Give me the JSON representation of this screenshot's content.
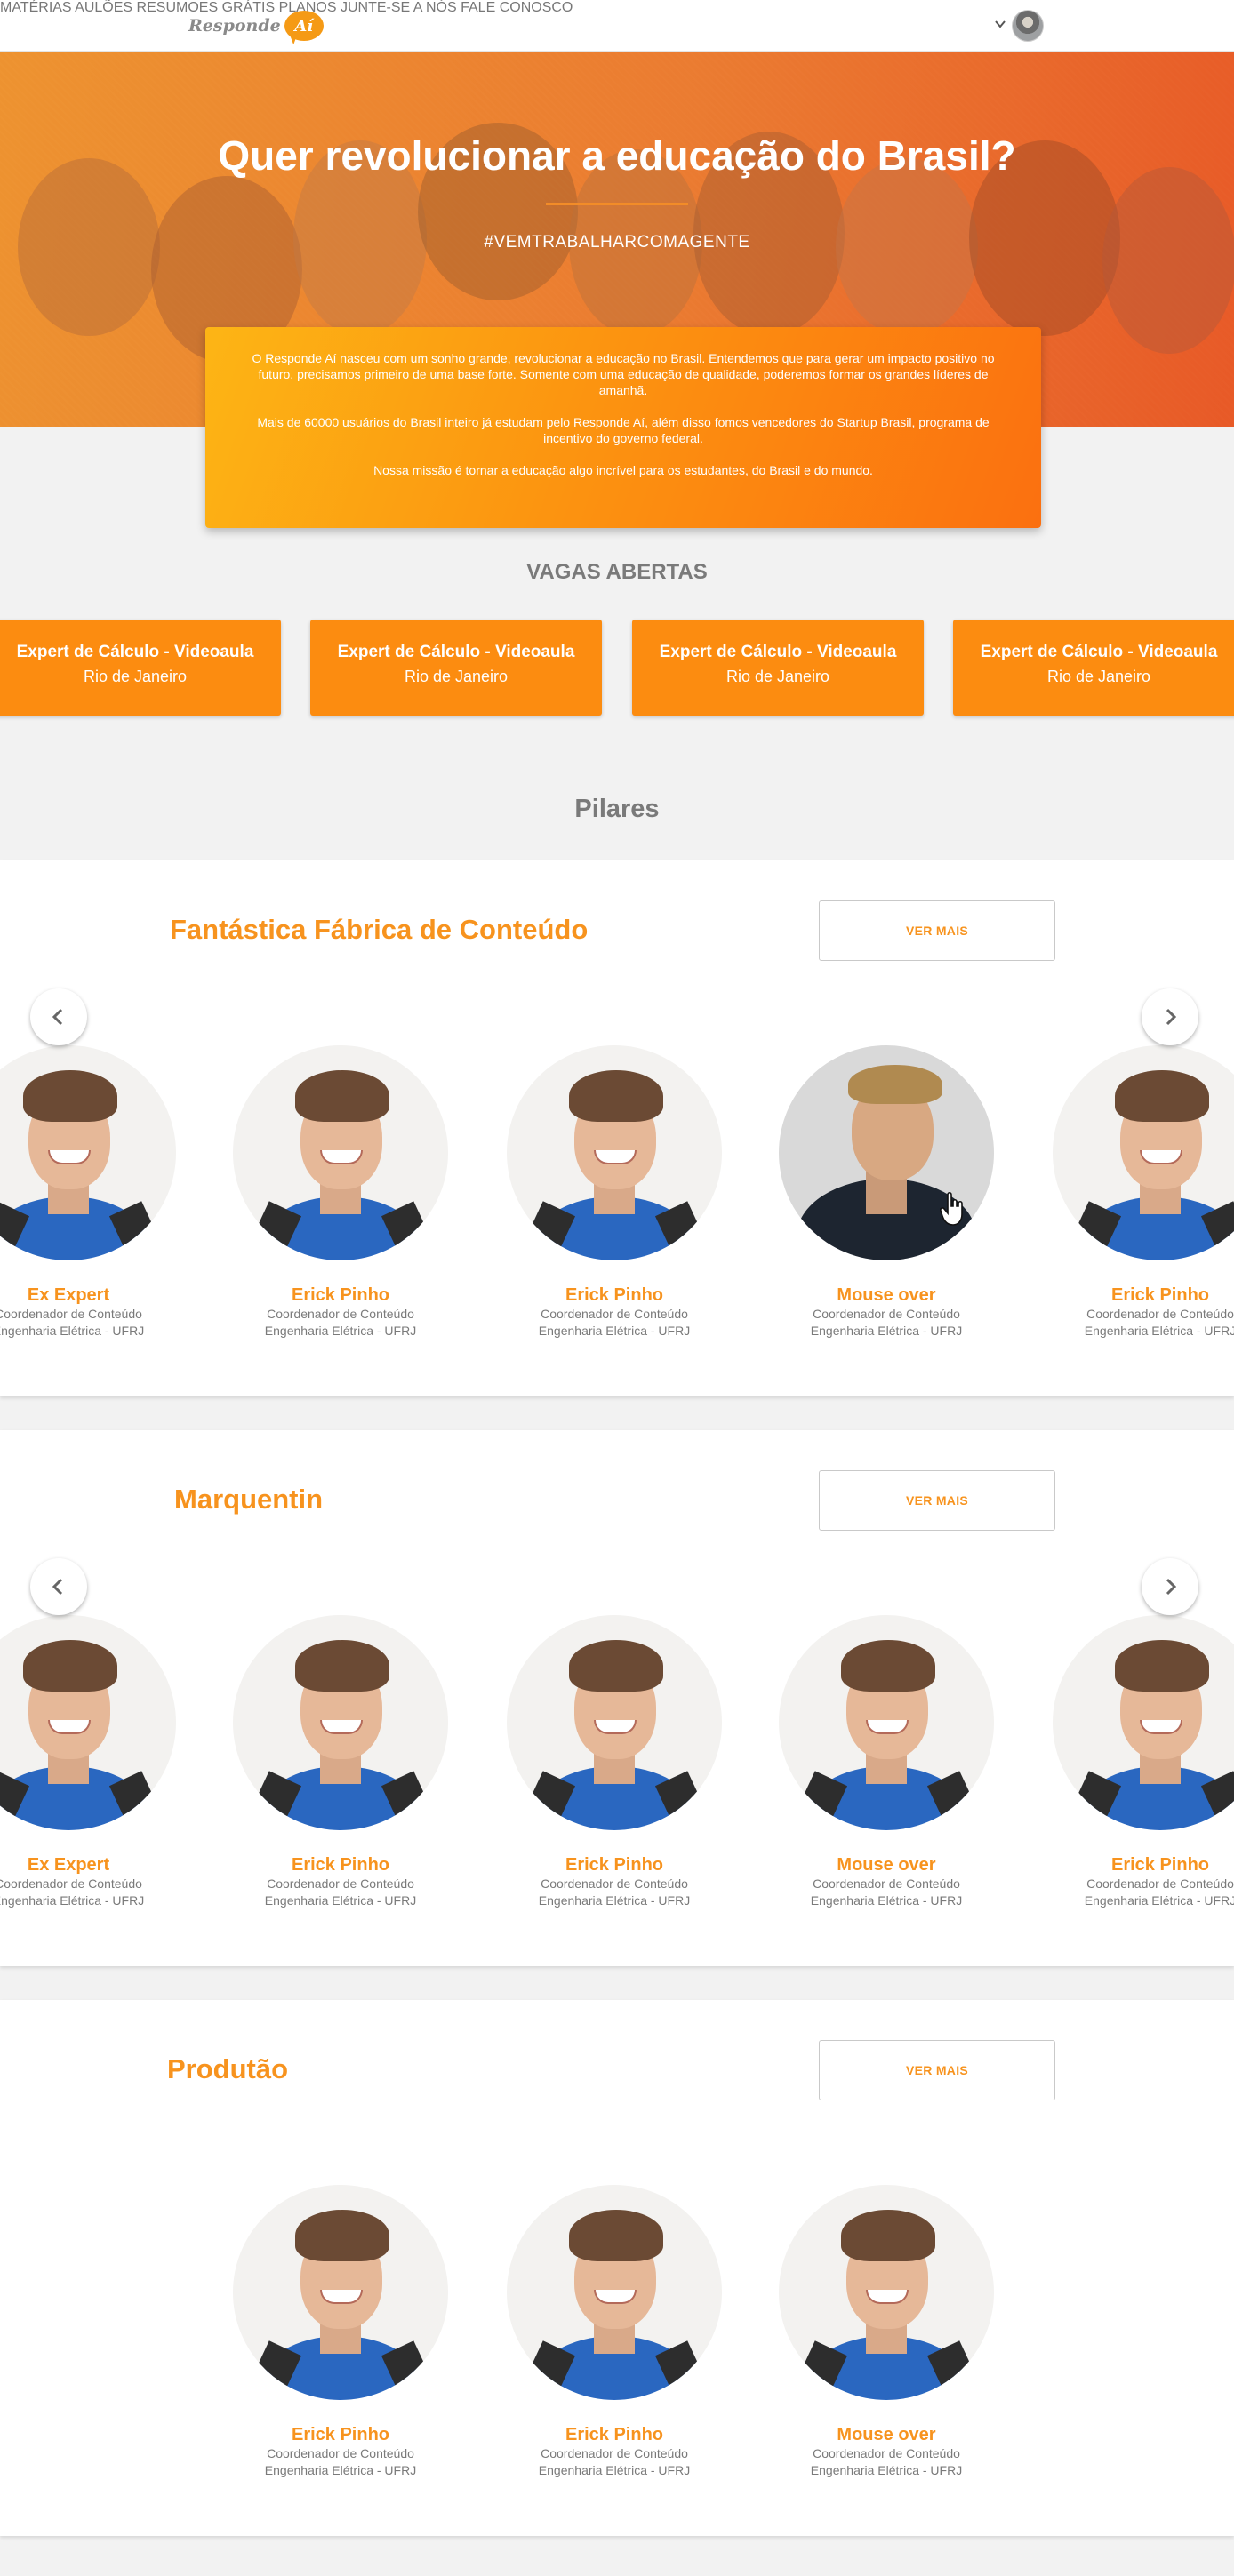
{
  "nav": {
    "logo_text": "Responde",
    "logo_badge": "Aí",
    "items": [
      "MATÉRIAS",
      "AULÕES",
      "RESUMOES GRÁTIS",
      "PLANOS",
      "JUNTE-SE A NÓS",
      "FALE CONOSCO"
    ]
  },
  "hero": {
    "title": "Quer revolucionar a educação do Brasil?",
    "hashtag": "#VEMTRABALHARCOMAGENTE"
  },
  "intro": {
    "p1": "O Responde Aí nasceu com um sonho grande, revolucionar a educação no Brasil. Entendemos que para gerar um impacto positivo no futuro, precisamos primeiro de uma base forte. Somente com uma educação de qualidade, poderemos formar os grandes líderes de amanhã.",
    "p2": "Mais de 60000 usuários do Brasil inteiro já estudam pelo Responde Aí, além disso fomos vencedores do Startup Brasil, programa de incentivo do governo federal.",
    "p3": "Nossa missão é tornar a educação algo incrível para os estudantes, do Brasil e do mundo."
  },
  "vagas": {
    "title": "VAGAS ABERTAS",
    "jobs": [
      {
        "title": "Expert de Cálculo - Videoaula",
        "location": "Rio de Janeiro"
      },
      {
        "title": "Expert de Cálculo - Videoaula",
        "location": "Rio de Janeiro"
      },
      {
        "title": "Expert de Cálculo - Videoaula",
        "location": "Rio de Janeiro"
      },
      {
        "title": "Expert de Cálculo - Videoaula",
        "location": "Rio de Janeiro"
      }
    ]
  },
  "pilares": {
    "title": "Pilares",
    "ver_mais": "VER MAIS",
    "groups": [
      {
        "title": "Fantástica Fábrica de Conteúdo",
        "people": [
          {
            "name": "Ex Expert",
            "role": "Coordenador de Conteúdo",
            "course": "Engenharia Elétrica - UFRJ"
          },
          {
            "name": "Erick Pinho",
            "role": "Coordenador de Conteúdo",
            "course": "Engenharia Elétrica - UFRJ"
          },
          {
            "name": "Erick Pinho",
            "role": "Coordenador de Conteúdo",
            "course": "Engenharia Elétrica - UFRJ"
          },
          {
            "name": "Mouse over",
            "role": "Coordenador de Conteúdo",
            "course": "Engenharia Elétrica - UFRJ"
          },
          {
            "name": "Erick Pinho",
            "role": "Coordenador de Conteúdo",
            "course": "Engenharia Elétrica - UFRJ"
          }
        ]
      },
      {
        "title": "Marquentin",
        "people": [
          {
            "name": "Ex Expert",
            "role": "Coordenador de Conteúdo",
            "course": "Engenharia Elétrica - UFRJ"
          },
          {
            "name": "Erick Pinho",
            "role": "Coordenador de Conteúdo",
            "course": "Engenharia Elétrica - UFRJ"
          },
          {
            "name": "Erick Pinho",
            "role": "Coordenador de Conteúdo",
            "course": "Engenharia Elétrica - UFRJ"
          },
          {
            "name": "Mouse over",
            "role": "Coordenador de Conteúdo",
            "course": "Engenharia Elétrica - UFRJ"
          },
          {
            "name": "Erick Pinho",
            "role": "Coordenador de Conteúdo",
            "course": "Engenharia Elétrica - UFRJ"
          }
        ]
      },
      {
        "title": "Produtão",
        "people": [
          {
            "name": "Erick Pinho",
            "role": "Coordenador de Conteúdo",
            "course": "Engenharia Elétrica - UFRJ"
          },
          {
            "name": "Erick Pinho",
            "role": "Coordenador de Conteúdo",
            "course": "Engenharia Elétrica - UFRJ"
          },
          {
            "name": "Mouse over",
            "role": "Coordenador de Conteúdo",
            "course": "Engenharia Elétrica - UFRJ"
          }
        ]
      }
    ]
  },
  "colors": {
    "accent": "#f7931e",
    "job_card": "#fc8c10",
    "intro_start": "#fdb515",
    "intro_end": "#fb7010"
  },
  "icons": [
    "chevron-left-icon",
    "chevron-right-icon",
    "chevron-down-icon",
    "hand-cursor-icon",
    "user-avatar-icon"
  ]
}
